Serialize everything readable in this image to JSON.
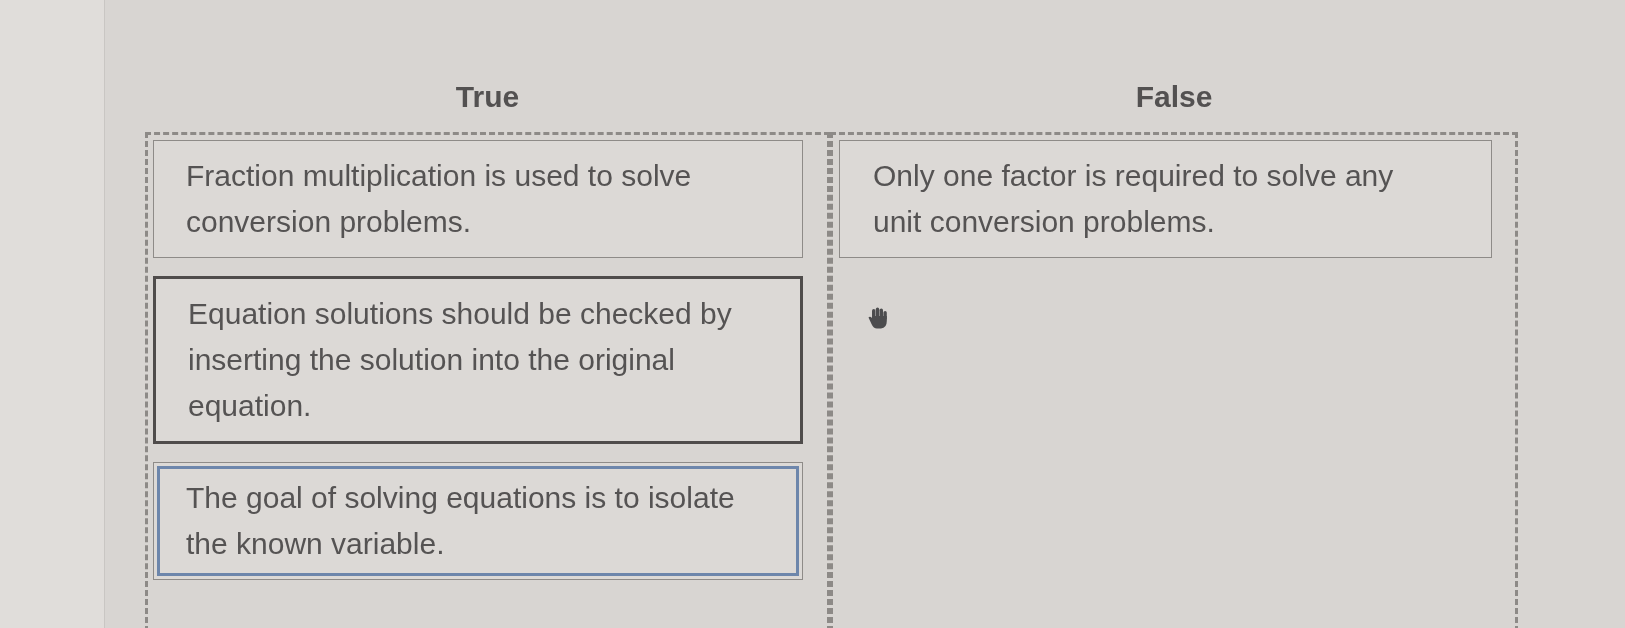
{
  "columns": [
    {
      "heading": "True",
      "cards": [
        {
          "text": "Fraction multiplication is used to solve conversion problems.",
          "hovered": false,
          "selected": false
        },
        {
          "text": "Equation solutions should be checked by inserting the solution into the original equation.",
          "hovered": true,
          "selected": false
        },
        {
          "text": "The goal of solving equations is to isolate the known variable.",
          "hovered": false,
          "selected": true
        }
      ]
    },
    {
      "heading": "False",
      "cards": [
        {
          "text": "Only one factor is required to solve any unit conversion problems.",
          "hovered": false,
          "selected": false
        }
      ]
    }
  ]
}
